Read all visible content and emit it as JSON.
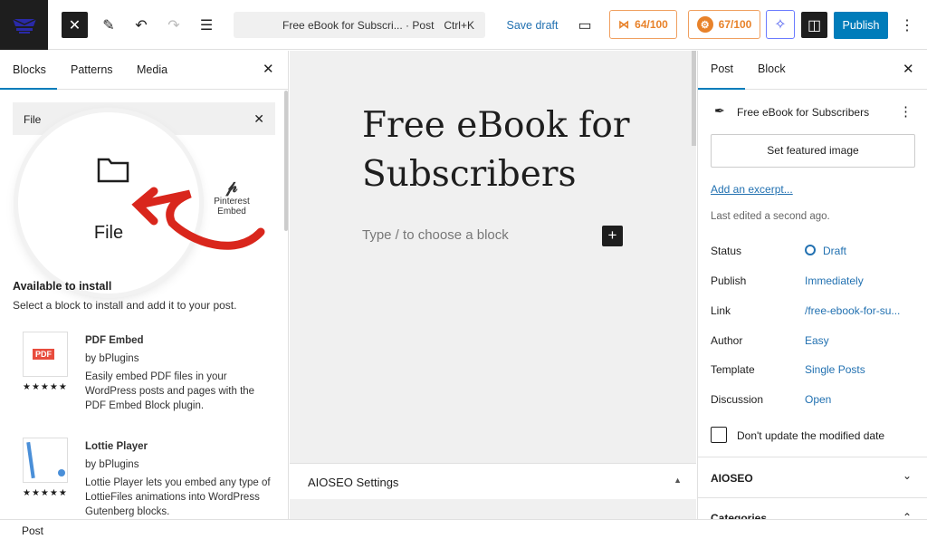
{
  "header": {
    "command_text": "Free eBook for Subscri... · Post",
    "shortcut": "Ctrl+K",
    "save_draft": "Save draft",
    "score1": "64/100",
    "score2": "67/100",
    "publish": "Publish"
  },
  "inserter": {
    "tabs": [
      "Blocks",
      "Patterns",
      "Media"
    ],
    "search_value": "File",
    "results": [
      {
        "label": "File"
      },
      {
        "label": "Pinterest Embed"
      }
    ],
    "available_heading": "Available to install",
    "available_desc": "Select a block to install and add it to your post.",
    "plugins": [
      {
        "name": "PDF Embed",
        "author": "by bPlugins",
        "desc": "Easily embed PDF files in your WordPress posts and pages with the PDF Embed Block plugin.",
        "rating": 5
      },
      {
        "name": "Lottie Player",
        "author": "by bPlugins",
        "desc": "Lottie Player lets you embed any type of LottieFiles animations into WordPress Gutenberg blocks.",
        "rating": 5
      }
    ]
  },
  "editor": {
    "title": "Free eBook for Subscribers",
    "placeholder": "Type / to choose a block",
    "aioseo_settings": "AIOSEO Settings"
  },
  "sidebar": {
    "tabs": [
      "Post",
      "Block"
    ],
    "post_title": "Free eBook for Subscribers",
    "featured_image": "Set featured image",
    "excerpt_link": "Add an excerpt...",
    "last_edited": "Last edited a second ago.",
    "fields": [
      {
        "label": "Status",
        "value": "Draft"
      },
      {
        "label": "Publish",
        "value": "Immediately"
      },
      {
        "label": "Link",
        "value": "/free-ebook-for-su..."
      },
      {
        "label": "Author",
        "value": "Easy"
      },
      {
        "label": "Template",
        "value": "Single Posts"
      },
      {
        "label": "Discussion",
        "value": "Open"
      }
    ],
    "modified_checkbox": "Don't update the modified date",
    "panels": [
      "AIOSEO",
      "Categories"
    ]
  },
  "footer": {
    "breadcrumb": "Post"
  },
  "colors": {
    "accent": "#007cba",
    "link": "#2271b1",
    "score": "#e8822a",
    "arrow": "#d9261c"
  }
}
